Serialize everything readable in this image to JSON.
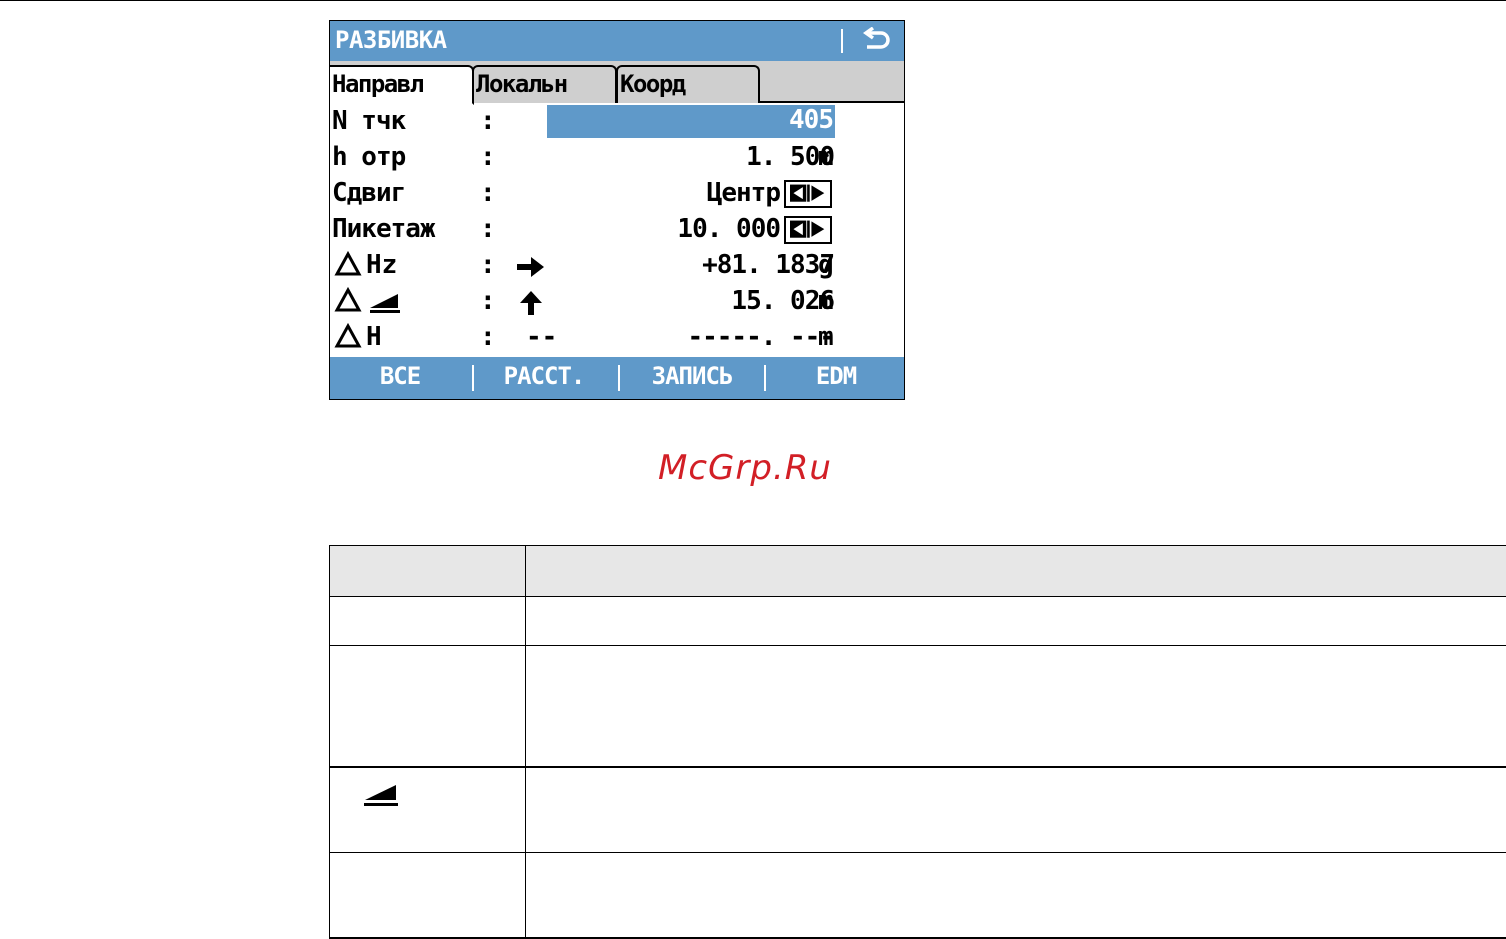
{
  "screen": {
    "title": "РАЗБИВКА",
    "back_icon": "return-arrow-icon",
    "tabs": [
      {
        "label": "Направл",
        "active": true
      },
      {
        "label": "Локальн",
        "active": false
      },
      {
        "label": "Коорд",
        "active": false
      }
    ],
    "fields": {
      "point_id": {
        "label": "N тчк",
        "colon": ":",
        "value": "405"
      },
      "reflector_height": {
        "label": "h отр",
        "colon": ":",
        "value": "1. 500",
        "unit": "m"
      },
      "offset": {
        "label": "Сдвиг",
        "colon": ":",
        "value": "Центр"
      },
      "chainage": {
        "label": "Пикетаж",
        "colon": ":",
        "value": "10. 000"
      },
      "delta_hz": {
        "label": "Hz",
        "colon": ":",
        "value": "+81. 1837",
        "unit": "g",
        "arrow": "right-arrow-icon"
      },
      "delta_slope": {
        "colon": ":",
        "value": "15. 026",
        "unit": "m",
        "arrow": "up-arrow-icon"
      },
      "delta_height": {
        "label": "H",
        "colon": ":",
        "dash": "--",
        "value": "-----. ---",
        "unit": "m"
      }
    },
    "softkeys": [
      "ВСЕ",
      "РАССТ.",
      "ЗАПИСЬ",
      "EDM"
    ]
  },
  "watermark": "McGrp.Ru",
  "colors": {
    "accent": "#5f99c9",
    "watermark": "#d21f26",
    "table_header": "#e7e7e7"
  }
}
